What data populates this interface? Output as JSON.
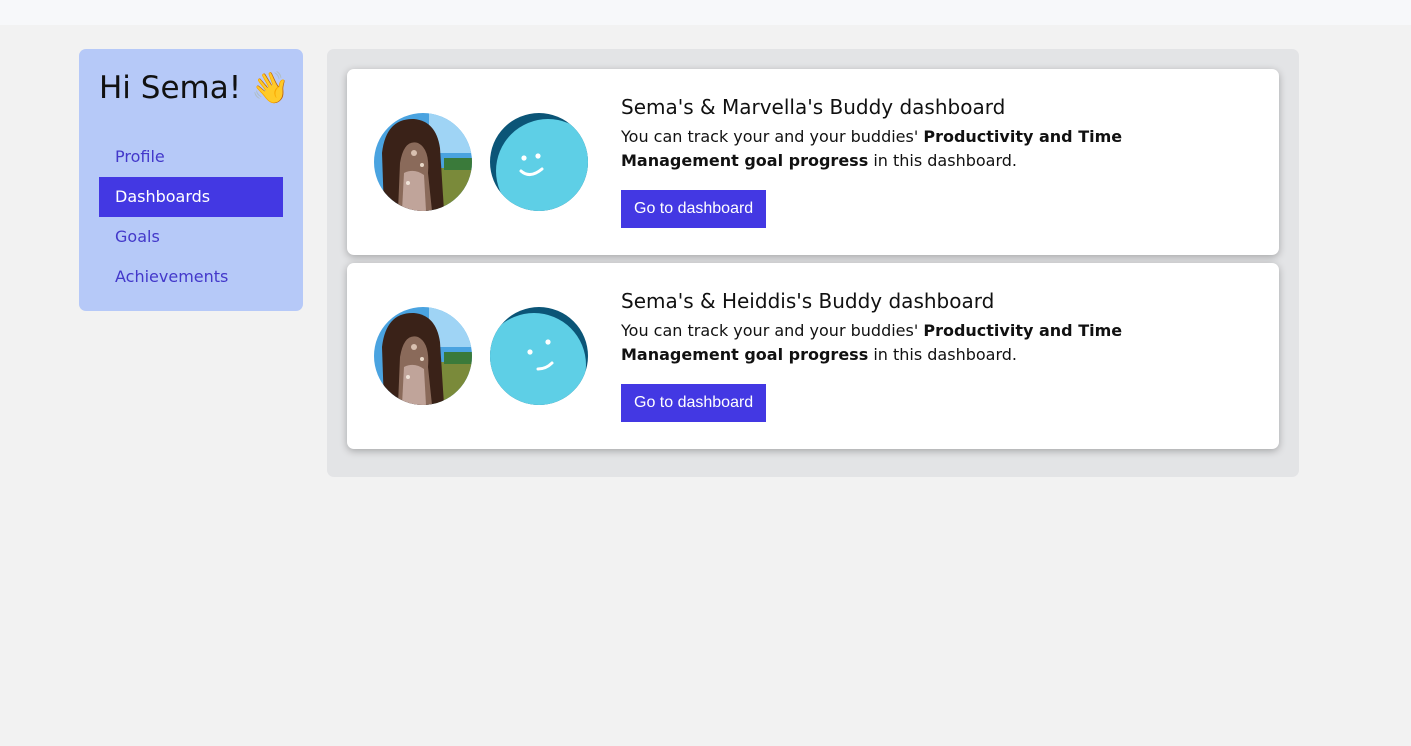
{
  "sidebar": {
    "greeting": "Hi Sema!",
    "wave_emoji": "👋",
    "items": [
      {
        "label": "Profile",
        "active": false
      },
      {
        "label": "Dashboards",
        "active": true
      },
      {
        "label": "Goals",
        "active": false
      },
      {
        "label": "Achievements",
        "active": false
      }
    ]
  },
  "dashboards": [
    {
      "title": "Sema's & Marvella's Buddy dashboard",
      "desc_prefix": "You can track your and your buddies'",
      "desc_bold": "Productivity and Time Management goal progress",
      "desc_suffix": "in this dashboard.",
      "button_label": "Go to dashboard"
    },
    {
      "title": "Sema's & Heiddis's Buddy dashboard",
      "desc_prefix": "You can track your and your buddies'",
      "desc_bold": "Productivity and Time Management goal progress",
      "desc_suffix": "in this dashboard.",
      "button_label": "Go to dashboard"
    }
  ],
  "colors": {
    "accent": "#4338e3",
    "sidebar_bg": "#b6c9f8",
    "buddy_avatar_light": "#5ecfe6",
    "buddy_avatar_dark": "#0b5577"
  },
  "icons": {
    "user_avatar": "user-photo-avatar",
    "buddy_avatar": "smiley-avatar"
  }
}
